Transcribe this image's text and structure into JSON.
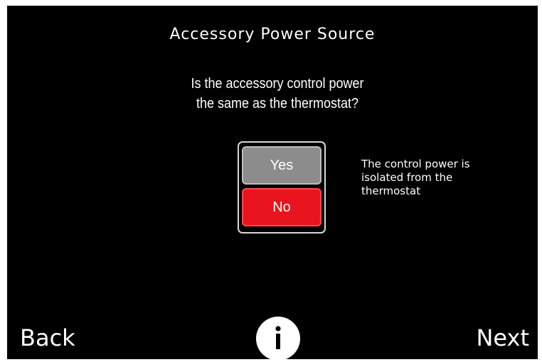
{
  "screen": {
    "title": "Accessory Power Source",
    "question": "Is the accessory control power\nthe same as the thermostat?",
    "options": [
      {
        "label": "Yes",
        "selected": false
      },
      {
        "label": "No",
        "selected": true
      }
    ],
    "description": "The control power is\nisolated from the\nthermostat"
  },
  "nav": {
    "back_label": "Back",
    "next_label": "Next",
    "info_icon": "info-icon"
  },
  "colors": {
    "background": "#000000",
    "text": "#ffffff",
    "unselected_option": "#8c8c8c",
    "selected_option": "#e8151e"
  }
}
